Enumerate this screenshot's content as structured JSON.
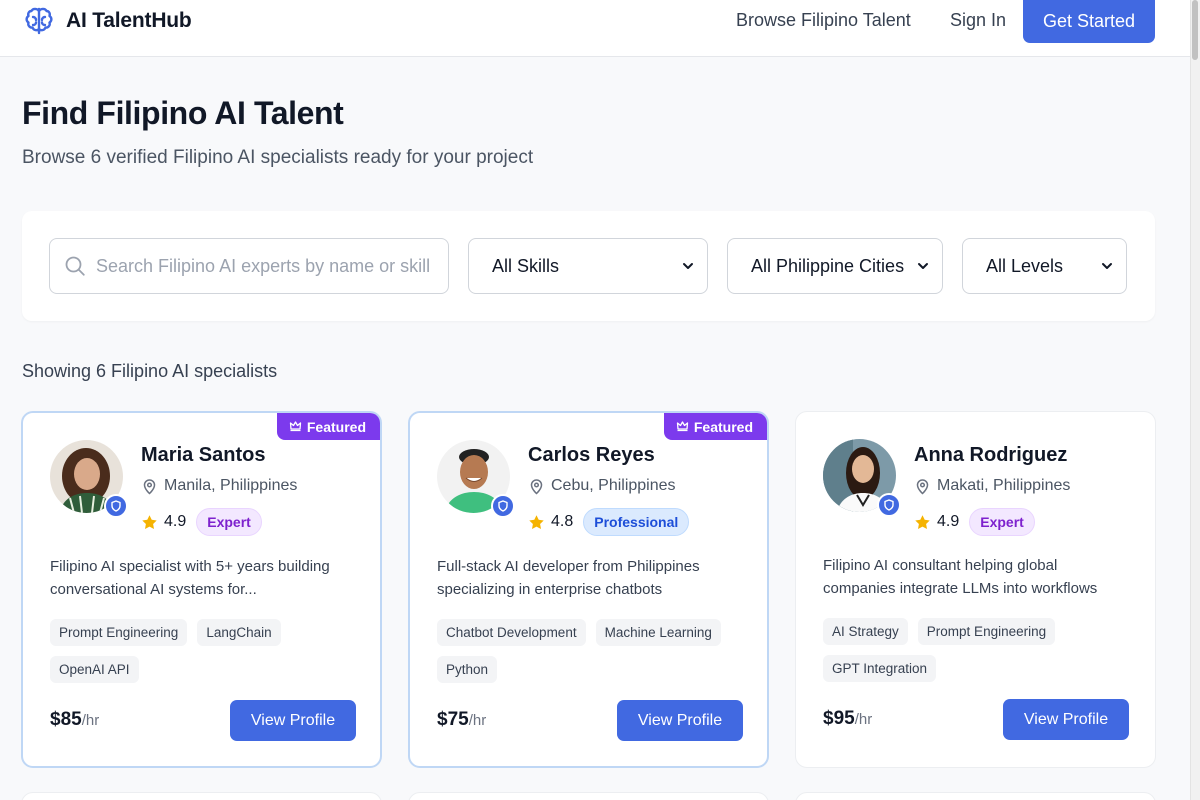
{
  "header": {
    "brand": "AI TalentHub",
    "nav": {
      "browse": "Browse Filipino Talent",
      "signin": "Sign In",
      "cta": "Get Started"
    }
  },
  "page": {
    "title": "Find Filipino AI Talent",
    "subtitle": "Browse 6 verified Filipino AI specialists ready for your project"
  },
  "filters": {
    "search_placeholder": "Search Filipino AI experts by name or skill",
    "skills": "All Skills",
    "cities": "All Philippine Cities",
    "levels": "All Levels"
  },
  "results": {
    "count_text": "Showing 6 Filipino AI specialists"
  },
  "cards": [
    {
      "featured": "Featured",
      "name": "Maria Santos",
      "location": "Manila, Philippines",
      "rating": "4.9",
      "level": "Expert",
      "description": "Filipino AI specialist with 5+ years building conversational AI systems for...",
      "tags": [
        "Prompt Engineering",
        "LangChain",
        "OpenAI API"
      ],
      "price": "$85",
      "unit": "/hr",
      "button": "View Profile"
    },
    {
      "featured": "Featured",
      "name": "Carlos Reyes",
      "location": "Cebu, Philippines",
      "rating": "4.8",
      "level": "Professional",
      "description": "Full-stack AI developer from Philippines specializing in enterprise chatbots",
      "tags": [
        "Chatbot Development",
        "Machine Learning",
        "Python"
      ],
      "price": "$75",
      "unit": "/hr",
      "button": "View Profile"
    },
    {
      "name": "Anna Rodriguez",
      "location": "Makati, Philippines",
      "rating": "4.9",
      "level": "Expert",
      "description": "Filipino AI consultant helping global companies integrate LLMs into workflows",
      "tags": [
        "AI Strategy",
        "Prompt Engineering",
        "GPT Integration"
      ],
      "price": "$95",
      "unit": "/hr",
      "button": "View Profile"
    }
  ],
  "colors": {
    "primary": "#4169e1",
    "featured": "#7c3aed",
    "star": "#f5b301"
  }
}
